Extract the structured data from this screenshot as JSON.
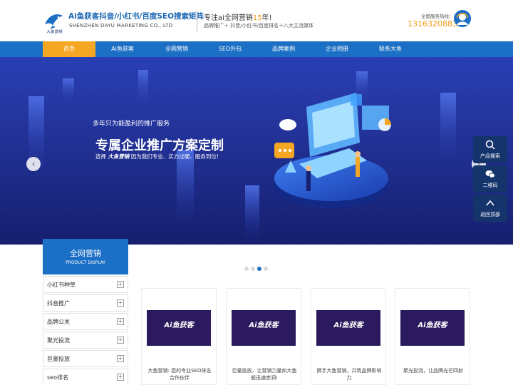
{
  "header": {
    "brand_title": "Ai鱼获客抖音/小红书/百度SEO搜索矩阵",
    "brand_subtitle": "SHENZHEN DAYU MARKETING CO., LTD",
    "logo_text": "大鱼营销",
    "slogan_prefix": "专注ai全网营销",
    "slogan_years": "15",
    "slogan_suffix": "年!",
    "tagline": "品牌推广＋ 抖音/小红书/百度排名＋八大主流媒体",
    "hotline_label": "全国服务热线：",
    "hotline_number": "13163208830"
  },
  "nav": {
    "items": [
      {
        "label": "首页",
        "active": true
      },
      {
        "label": "Ai鱼获客"
      },
      {
        "label": "全网营销"
      },
      {
        "label": "SEO外包"
      },
      {
        "label": "品牌案例"
      },
      {
        "label": "企业相册"
      },
      {
        "label": "联系大鱼"
      }
    ]
  },
  "banner": {
    "kicker": "多年只为能盈利的推广服务",
    "title": "专属企业推广方案定制",
    "desc_prefix": "选择",
    "desc_brand": "大鱼营销",
    "desc_suffix": "因为我们专业、实力过硬、服务到位!",
    "prev_arrow": "‹",
    "next_arrow": "›",
    "slide_count": 4,
    "active_slide": 3
  },
  "side_tools": [
    {
      "label": "产品搜索",
      "icon": "search-icon"
    },
    {
      "label": "二维码",
      "icon": "wechat-icon"
    },
    {
      "label": "返回顶部",
      "icon": "arrow-up-icon"
    }
  ],
  "sidebar": {
    "title": "全网营销",
    "subtitle": "PRODUCT DISPLAY",
    "expand_symbol": "+",
    "items": [
      {
        "label": "小红书种草"
      },
      {
        "label": "抖音推广"
      },
      {
        "label": "品牌公关"
      },
      {
        "label": "聚光投流"
      },
      {
        "label": "巨量投放"
      },
      {
        "label": "seo排名"
      }
    ]
  },
  "products": [
    {
      "thumb_title": "Ai鱼获客",
      "caption": "大鱼营销: 您的专业SEO排名合作伙伴"
    },
    {
      "thumb_title": "Ai鱼获客",
      "caption": "巨量投放，让营销力量如大鱼般迅速彦洞!"
    },
    {
      "thumb_title": "Ai鱼获客",
      "caption": "携手大鱼营销，共筑品牌影响力"
    },
    {
      "thumb_title": "Ai鱼获客",
      "caption": "聚光投流，让品牌光芒四射"
    }
  ],
  "colors": {
    "primary": "#1b6fc4",
    "accent": "#f5a623",
    "banner_bg": "#1c2a8e",
    "side_tool_bg": "#15346b"
  }
}
